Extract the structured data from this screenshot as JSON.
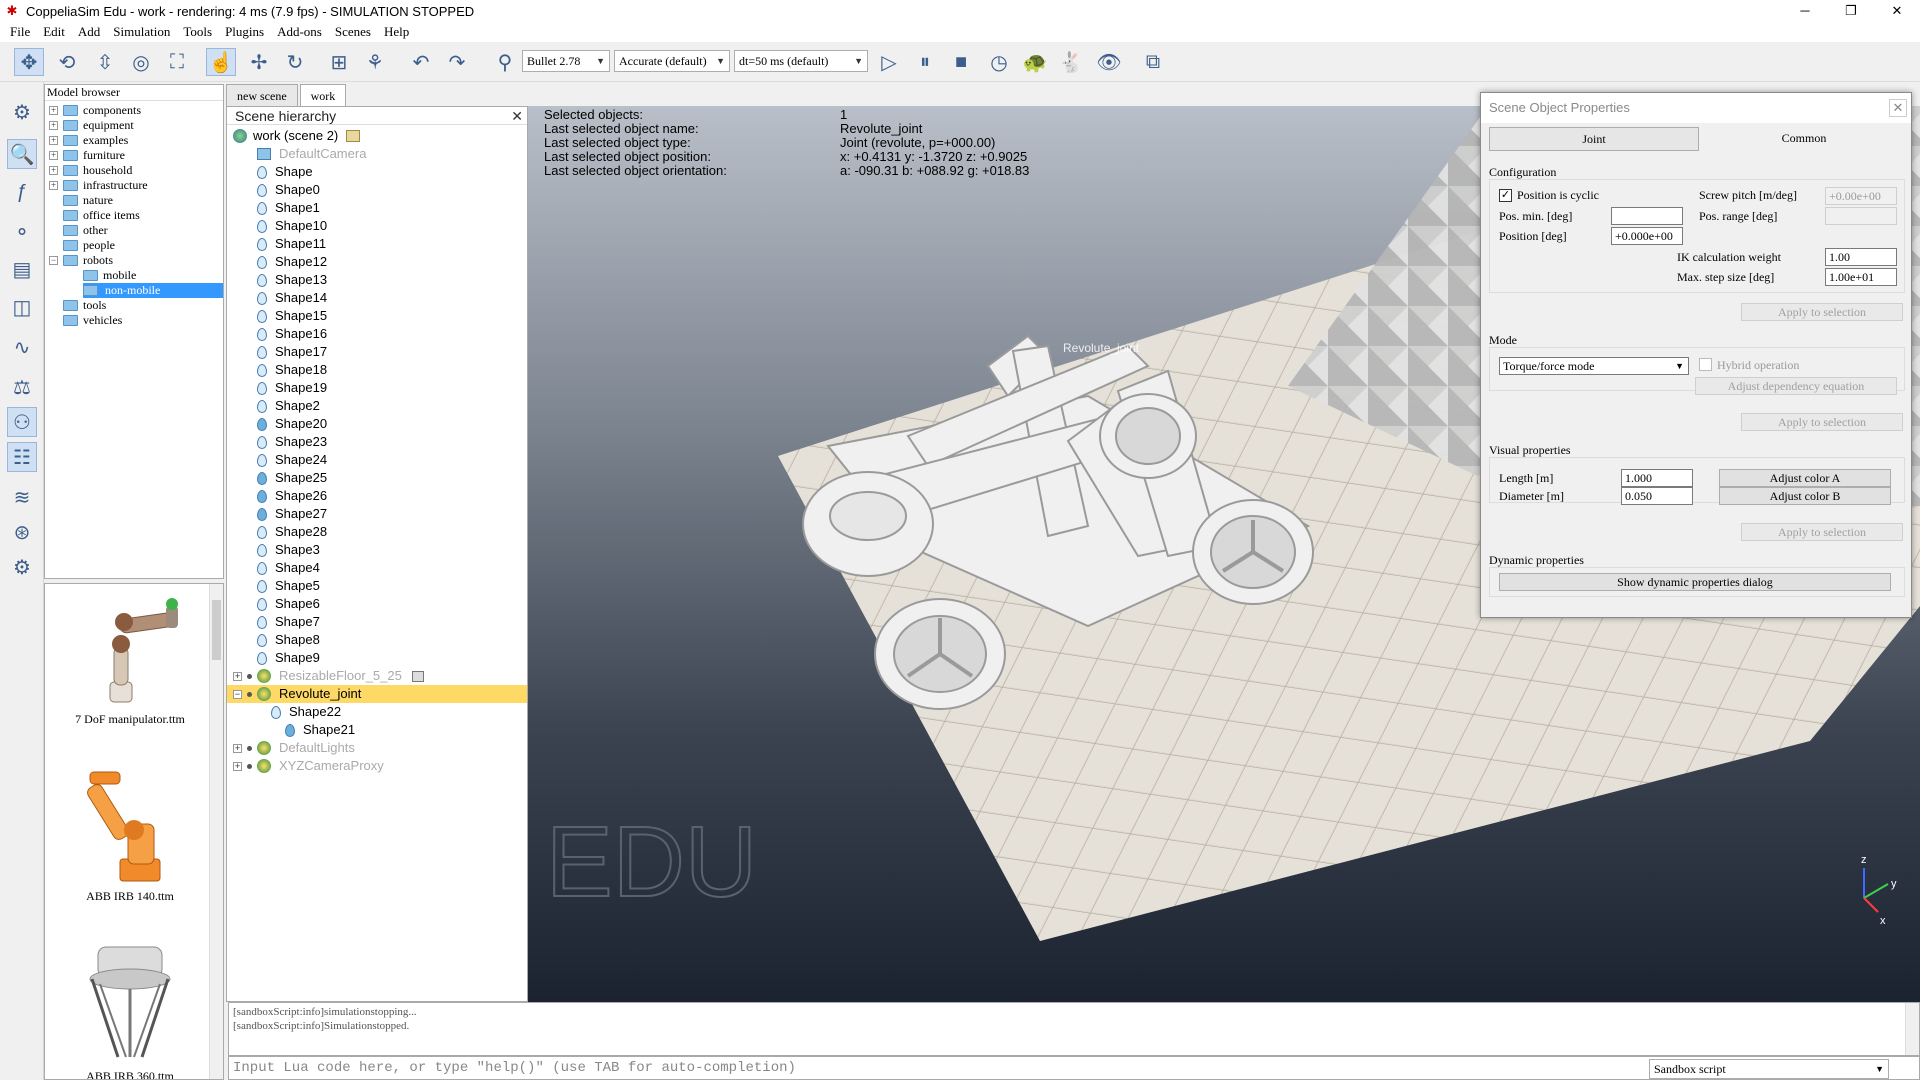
{
  "window": {
    "title": "CoppeliaSim Edu - work - rendering: 4 ms (7.9 fps) - SIMULATION STOPPED",
    "minimize": "─",
    "maximize": "❐",
    "close": "✕"
  },
  "menu": [
    "File",
    "Edit",
    "Add",
    "Simulation",
    "Tools",
    "Plugins",
    "Add-ons",
    "Scenes",
    "Help"
  ],
  "toolbar": {
    "engine": "Bullet 2.78",
    "accuracy": "Accurate (default)",
    "timestep": "dt=50 ms (default)"
  },
  "model_browser": {
    "title": "Model browser",
    "folders": [
      {
        "label": "components",
        "expander": "+"
      },
      {
        "label": "equipment",
        "expander": "+"
      },
      {
        "label": "examples",
        "expander": "+"
      },
      {
        "label": "furniture",
        "expander": "+"
      },
      {
        "label": "household",
        "expander": "+"
      },
      {
        "label": "infrastructure",
        "expander": "+"
      },
      {
        "label": "nature",
        "expander": ""
      },
      {
        "label": "office items",
        "expander": ""
      },
      {
        "label": "other",
        "expander": ""
      },
      {
        "label": "people",
        "expander": ""
      },
      {
        "label": "robots",
        "expander": "−"
      },
      {
        "label": "mobile",
        "expander": ""
      },
      {
        "label": "non-mobile",
        "expander": ""
      },
      {
        "label": "tools",
        "expander": ""
      },
      {
        "label": "vehicles",
        "expander": ""
      }
    ],
    "selected": "non-mobile",
    "thumbnails": [
      "7 DoF manipulator.ttm",
      "ABB IRB 140.ttm",
      "ABB IRB 360.ttm"
    ]
  },
  "scene_tabs": [
    "new scene",
    "work"
  ],
  "active_scene_tab": "work",
  "hierarchy": {
    "title": "Scene hierarchy",
    "close": "✕",
    "root": "work (scene 2)",
    "items": [
      "DefaultCamera",
      "Shape",
      "Shape0",
      "Shape1",
      "Shape10",
      "Shape11",
      "Shape12",
      "Shape13",
      "Shape14",
      "Shape15",
      "Shape16",
      "Shape17",
      "Shape18",
      "Shape19",
      "Shape2",
      "Shape20",
      "Shape23",
      "Shape24",
      "Shape25",
      "Shape26",
      "Shape27",
      "Shape28",
      "Shape3",
      "Shape4",
      "Shape5",
      "Shape6",
      "Shape7",
      "Shape8",
      "Shape9",
      "ResizableFloor_5_25",
      "Revolute_joint",
      "Shape22",
      "Shape21",
      "DefaultLights",
      "XYZCameraProxy"
    ],
    "selected": "Revolute_joint"
  },
  "overlay": {
    "rows": [
      {
        "k": "Selected objects:",
        "v": "1"
      },
      {
        "k": "Last selected object name:",
        "v": "Revolute_joint"
      },
      {
        "k": "Last selected object type:",
        "v": "Joint (revolute, p=+000.00)"
      },
      {
        "k": "Last selected object position:",
        "v": "x: +0.4131    y: -1.3720    z: +0.9025"
      },
      {
        "k": "Last selected object orientation:",
        "v": "a: -090.31    b: +088.92    g: +018.83"
      }
    ],
    "watermark": "EDU",
    "joint_label": "Revolute_joint",
    "axes": {
      "z": "z",
      "y": "y",
      "x": "x"
    }
  },
  "props": {
    "title": "Scene Object Properties",
    "close": "✕",
    "tab_joint": "Joint",
    "tab_common": "Common",
    "config_title": "Configuration",
    "cyclic_label": "Position is cyclic",
    "cyclic_check": "✓",
    "screw_label": "Screw pitch [m/deg]",
    "screw_value": "+0.00e+00",
    "posmin_label": "Pos. min. [deg]",
    "posmin_value": "",
    "posrange_label": "Pos. range [deg]",
    "posrange_value": "",
    "position_label": "Position [deg]",
    "position_value": "+0.000e+00",
    "ikweight_label": "IK calculation weight",
    "ikweight_value": "1.00",
    "maxstep_label": "Max. step size [deg]",
    "maxstep_value": "1.00e+01",
    "apply": "Apply to selection",
    "mode_title": "Mode",
    "mode_value": "Torque/force mode",
    "hybrid_label": "Hybrid operation",
    "adjust_dep": "Adjust dependency equation",
    "visual_title": "Visual properties",
    "length_label": "Length [m]",
    "length_value": "1.000",
    "diameter_label": "Diameter [m]",
    "diameter_value": "0.050",
    "color_a": "Adjust color A",
    "color_b": "Adjust color B",
    "dyn_title": "Dynamic properties",
    "dyn_button": "Show dynamic properties dialog"
  },
  "console": {
    "lines": [
      "[sandboxScript:info]simulationstopping...",
      "[sandboxScript:info]Simulationstopped."
    ]
  },
  "lua": {
    "placeholder": "Input Lua code here, or type \"help()\" (use TAB for auto-completion)",
    "script": "Sandbox script"
  },
  "colors": {
    "selection_yellow": "#ffd966",
    "selection_blue": "#3399ff",
    "icon_blue": "#3b5e8c"
  }
}
